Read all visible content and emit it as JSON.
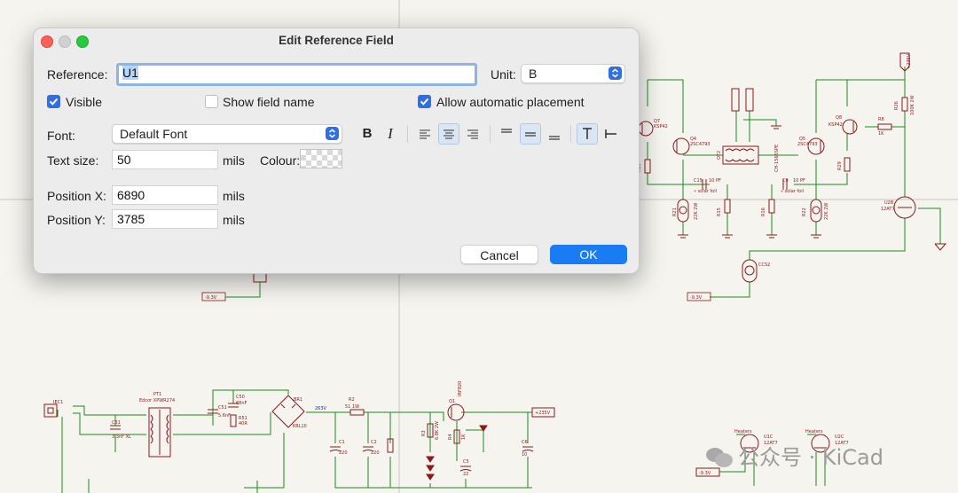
{
  "dialog": {
    "title": "Edit Reference Field",
    "reference_label": "Reference:",
    "reference_value": "U1",
    "unit_label": "Unit:",
    "unit_value": "B",
    "visible_label": "Visible",
    "visible_checked": true,
    "show_field_name_label": "Show field name",
    "show_field_name_checked": false,
    "allow_auto_placement_label": "Allow automatic placement",
    "allow_auto_placement_checked": true,
    "font_label": "Font:",
    "font_value": "Default Font",
    "bold_label": "B",
    "italic_label": "I",
    "text_size_label": "Text size:",
    "text_size_value": "50",
    "text_size_unit": "mils",
    "color_label": "Colour:",
    "position_x_label": "Position X:",
    "position_x_value": "6890",
    "position_x_unit": "mils",
    "position_y_label": "Position Y:",
    "position_y_value": "3785",
    "position_y_unit": "mils",
    "cancel_label": "Cancel",
    "ok_label": "OK"
  },
  "schematic": {
    "labels": {
      "q7": "Q7",
      "q7_part": "KSP42",
      "q4": "Q4",
      "q4_part": "2SC4793",
      "q5": "Q5",
      "q5_part": "2SC4793",
      "q8": "Q8",
      "q8_part": "KSP42",
      "r8": "R8",
      "r8_val": "1K",
      "r26": "R26",
      "r26_val": "100K 2W",
      "r30": "R30",
      "r29": "R29",
      "c15": "C15",
      "c15_val": "10 PF",
      "c9": "C9",
      "c9_val": "10 PF",
      "c15_note": "« solar foil",
      "c9_note": "« solar foil",
      "r15": "R15",
      "r16": "R16",
      "r21": "R21",
      "r22": "R22",
      "r21_val": "22K 2W",
      "r22_val": "22K 2W",
      "u2b": "U2B",
      "u2b_part": "12AT7",
      "ccs2": "CCS2",
      "ot2": "OT2",
      "ot2_part": "CH-1565SPE",
      "neg_rail_left": "-9.3V",
      "neg_rail_mid": "-9.3V",
      "neg_rail_bottom": "-9.3V",
      "plus_rail": "+235V",
      "plus_rail_top": "+235V",
      "iec1": "IEC1",
      "pt1": "PT1",
      "pt1_part": "Edcor XPWR274",
      "c31": "C31",
      "c31_val": "3.3nF XL",
      "c50": "C50",
      "c50_val": "68nF",
      "c51": "C51",
      "c51_val": "5.6nF",
      "r51": "R51",
      "r51_val": "40R",
      "br1": "BR1",
      "br1_part": "KBL10",
      "v263": "263V",
      "r2": "R2",
      "r2_val": "51 1W",
      "q1": "Q1",
      "q1_part": "IRF820",
      "c1": "C1",
      "c1_val": "220",
      "c2": "C2",
      "c2_val": "220",
      "c5": "C5",
      "c5_val": "22",
      "c6": "C6",
      "c6_val": "10",
      "r3": "R3",
      "r3_val": "6.8K 2W",
      "r4": "R4",
      "r4_val": "1K",
      "heaters1": "Heaters",
      "heaters2": "Heaters",
      "u1c": "U1C",
      "u1c_part": "12AT7",
      "u2c": "U2C",
      "u2c_part": "12AT7"
    },
    "watermark": "公众号 · KiCad"
  }
}
